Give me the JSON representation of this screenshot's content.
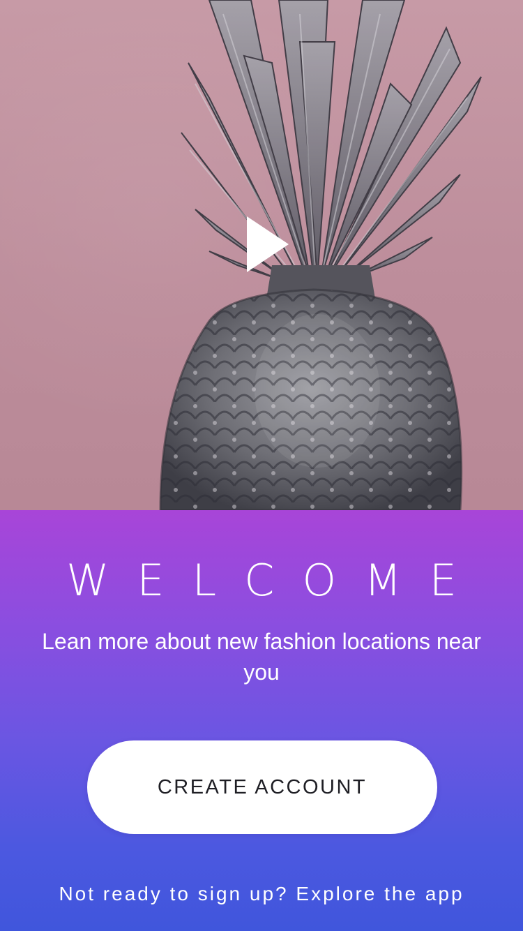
{
  "hero": {
    "media_type": "video",
    "play_icon": "play-icon",
    "background_color": "#c29aa5",
    "subject": "pineapple"
  },
  "welcome": {
    "title": "WELCOME",
    "subtitle": "Lean more about new fashion locations near you"
  },
  "actions": {
    "create_account_label": "CREATE ACCOUNT",
    "explore_label": "Not ready to sign up? Explore the app"
  },
  "colors": {
    "gradient_top": "#a845d8",
    "gradient_bottom": "#4056dc",
    "button_bg": "#ffffff",
    "button_text": "#1e1e24"
  }
}
